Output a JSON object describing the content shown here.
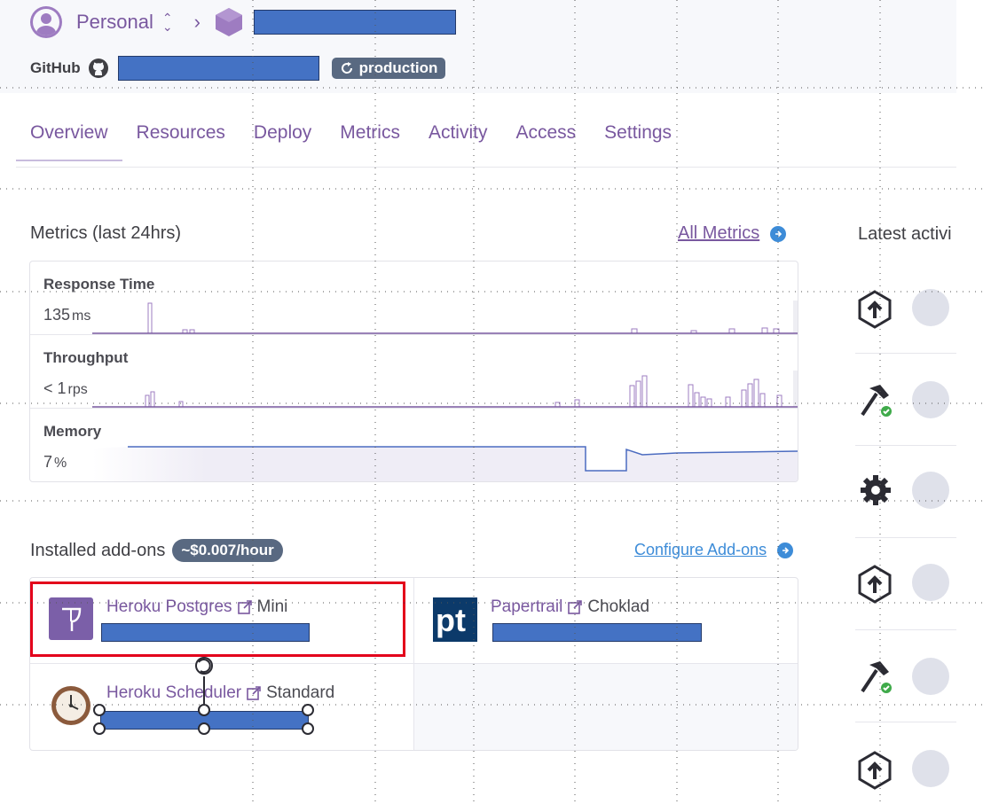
{
  "header": {
    "team_name": "Personal",
    "github_label": "GitHub",
    "pipeline_badge": "production"
  },
  "tabs": [
    {
      "label": "Overview"
    },
    {
      "label": "Resources"
    },
    {
      "label": "Deploy"
    },
    {
      "label": "Metrics"
    },
    {
      "label": "Activity"
    },
    {
      "label": "Access"
    },
    {
      "label": "Settings"
    }
  ],
  "metrics": {
    "title": "Metrics (last 24hrs)",
    "all_link": "All Metrics",
    "rows": [
      {
        "name": "Response Time",
        "value": "135",
        "unit": "ms"
      },
      {
        "name": "Throughput",
        "value": "< 1",
        "unit": "rps"
      },
      {
        "name": "Memory",
        "value": "7",
        "unit": "%"
      }
    ]
  },
  "activity": {
    "title": "Latest activi",
    "items": [
      {
        "icon": "deploy-upload-icon"
      },
      {
        "icon": "build-hammer-icon"
      },
      {
        "icon": "gear-icon"
      },
      {
        "icon": "deploy-upload-icon"
      },
      {
        "icon": "build-hammer-icon"
      },
      {
        "icon": "deploy-upload-icon"
      }
    ]
  },
  "addons": {
    "title": "Installed add-ons",
    "cost": "~$0.007/hour",
    "configure_link": "Configure Add-ons",
    "items": [
      {
        "name": "Heroku Postgres",
        "plan": "Mini",
        "icon": "postgres-icon"
      },
      {
        "name": "Papertrail",
        "plan": "Choklad",
        "icon": "papertrail-icon"
      },
      {
        "name": "Heroku Scheduler",
        "plan": "Standard",
        "icon": "scheduler-clock-icon"
      }
    ]
  },
  "colors": {
    "brand_purple": "#79589f",
    "link_blue": "#3d8cd8",
    "badge_slate": "#596981",
    "redaction_blue": "#4472c4",
    "highlight_red": "#e3001b"
  }
}
